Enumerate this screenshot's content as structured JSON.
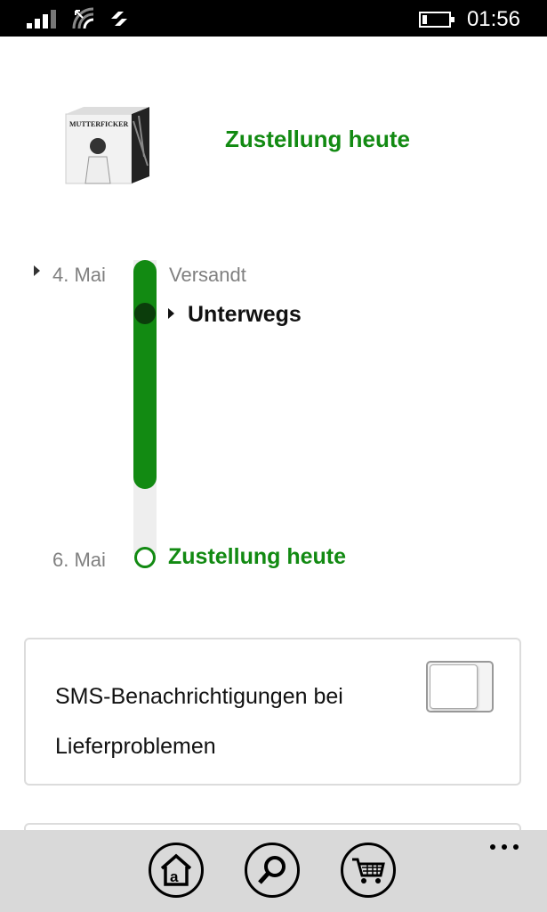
{
  "status_bar": {
    "time": "01:56",
    "icons": [
      "signal-icon",
      "wifi-icon",
      "data-sync-icon",
      "battery-icon"
    ]
  },
  "product": {
    "image_label": "MUTTERFICKER",
    "delivery_status": "Zustellung heute",
    "status_color": "#128a12"
  },
  "timeline": {
    "start_date": "4. Mai",
    "start_step": "Versandt",
    "current_step": "Unterwegs",
    "end_date": "6. Mai",
    "end_step": "Zustellung heute",
    "progress": 0.78
  },
  "notifications": {
    "sms_label": "SMS-Benachrichtigungen bei Lieferproblemen",
    "sms_enabled": false
  },
  "app_bar": {
    "buttons": [
      "home-icon",
      "search-icon",
      "cart-icon"
    ],
    "more": "more-icon"
  }
}
